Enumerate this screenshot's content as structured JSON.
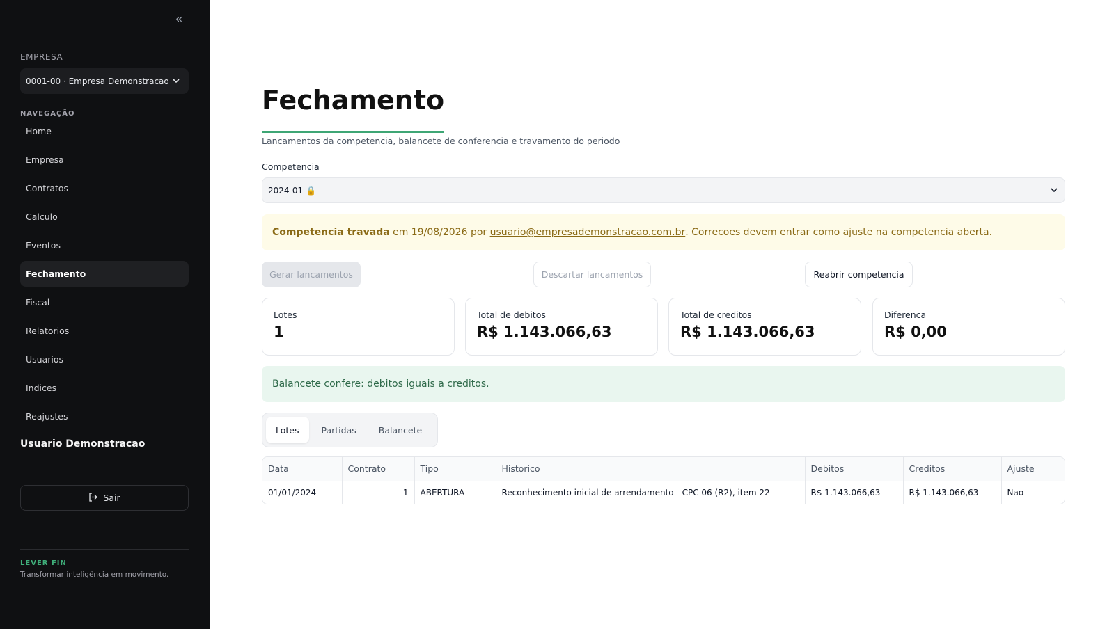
{
  "sidebar": {
    "empresa_label": "EMPRESA",
    "company_select_value": "0001-00 · Empresa Demonstracao",
    "nav_label": "NAVEGAÇÃO",
    "nav_items": [
      {
        "label": "Home"
      },
      {
        "label": "Empresa"
      },
      {
        "label": "Contratos"
      },
      {
        "label": "Calculo"
      },
      {
        "label": "Eventos"
      },
      {
        "label": "Fechamento",
        "active": true
      },
      {
        "label": "Fiscal"
      },
      {
        "label": "Relatorios"
      },
      {
        "label": "Usuarios"
      },
      {
        "label": "Indices"
      },
      {
        "label": "Reajustes"
      }
    ],
    "user_name": "Usuario Demonstracao",
    "logout_label": "Sair",
    "brand": "LEVER FIN",
    "tagline": "Transformar inteligência em movimento."
  },
  "page": {
    "title": "Fechamento",
    "subtitle": "Lancamentos da competencia, balancete de conferencia e travamento do periodo",
    "competencia_label": "Competencia",
    "competencia_value": "2024-01 🔒"
  },
  "warning": {
    "strong": "Competencia travada",
    "pre": " em 19/08/2026 por ",
    "email": "usuario@empresademonstracao.com.br",
    "post": ". Correcoes devem entrar como ajuste na competencia aberta."
  },
  "actions": {
    "gerar": "Gerar lancamentos",
    "descartar": "Descartar lancamentos",
    "reabrir": "Reabrir competencia"
  },
  "cards": [
    {
      "label": "Lotes",
      "value": "1"
    },
    {
      "label": "Total de debitos",
      "value": "R$ 1.143.066,63"
    },
    {
      "label": "Total de creditos",
      "value": "R$ 1.143.066,63"
    },
    {
      "label": "Diferenca",
      "value": "R$ 0,00"
    }
  ],
  "balance_ok": "Balancete confere: debitos iguais a creditos.",
  "tabs": [
    {
      "label": "Lotes",
      "active": true
    },
    {
      "label": "Partidas"
    },
    {
      "label": "Balancete"
    }
  ],
  "table": {
    "headers": [
      "Data",
      "Contrato",
      "Tipo",
      "Historico",
      "Debitos",
      "Creditos",
      "Ajuste"
    ],
    "rows": [
      [
        "01/01/2024",
        "1",
        "ABERTURA",
        "Reconhecimento inicial de arrendamento - CPC 06 (R2), item 22",
        "R$ 1.143.066,63",
        "R$ 1.143.066,63",
        "Nao"
      ]
    ]
  },
  "colors": {
    "sidebar_bg": "#0f1012",
    "accent_green": "#3ea675",
    "warning_bg": "#fefbe8",
    "warning_text": "#8a6a16",
    "success_bg": "#e9f6ef",
    "success_text": "#2f6a4a"
  },
  "icons": {
    "collapse": "double-chevron-left-icon",
    "select_chevron": "chevron-down-icon",
    "logout": "logout-icon"
  }
}
